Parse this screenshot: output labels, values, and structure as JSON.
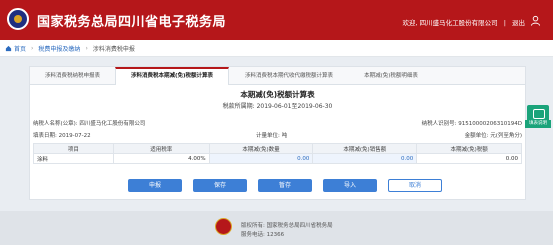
{
  "header": {
    "title": "国家税务总局四川省电子税务局",
    "welcome_prefix": "欢迎,",
    "company": "四川盛马化工股份有限公司",
    "sep": "|",
    "logout": "退出"
  },
  "breadcrumb": {
    "home": "首页",
    "items": [
      "税费申报及缴纳",
      "涉料消费税申报"
    ]
  },
  "tabs": [
    {
      "label": "涉料消费税纳税申报表"
    },
    {
      "label": "涉料消费税本期减(免)税额计算表"
    },
    {
      "label": "涉料消费税本期代收代缴税额计算表"
    },
    {
      "label": "本期减(免)税额明细表"
    }
  ],
  "form": {
    "title": "本期减(免)税额计算表",
    "period": "税款所属期: 2019-06-01至2019-06-30",
    "taxpayer_name": "纳税人名称(公章): 四川盛马化工股份有限公司",
    "taxpayer_id": "纳税人识别号: 91510000206310194D",
    "fill_date": "填表日期: 2019-07-22",
    "unit": "计量单位: 吨",
    "amount_unit": "金额单位: 元(列至角分)"
  },
  "table": {
    "headers": [
      "项目",
      "适用税率",
      "本期减(免)数量",
      "本期减(免)销售额",
      "本期减(免)税额"
    ],
    "rows": [
      {
        "item": "涂料",
        "rate": "4.00%",
        "qty": "0.00",
        "sales": "0.00",
        "tax": "0.00"
      }
    ]
  },
  "buttons": {
    "declare": "申报",
    "save": "保存",
    "temp_save": "暂存",
    "import": "导入",
    "cancel": "取消"
  },
  "float": {
    "label": "填表说明"
  },
  "footer": {
    "owner": "版权所有: 国家税务总局四川省税务局",
    "hotline": "服务电话: 12366"
  },
  "colors": {
    "brand": "#b5171a",
    "button": "#3d7fd6",
    "float_widget": "#1aa37a"
  }
}
